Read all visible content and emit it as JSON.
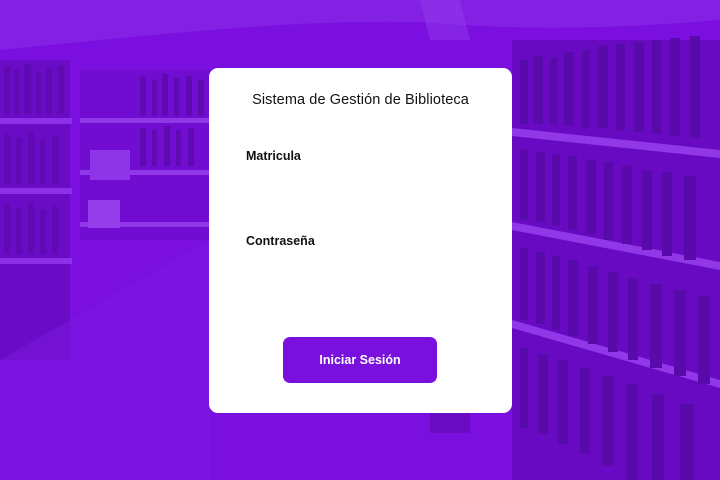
{
  "colors": {
    "background_overlay": "#7a0fe0",
    "card": "#ffffff",
    "button": "#7a10dd",
    "button_text": "#ffffff"
  },
  "login": {
    "title": "Sistema de Gestión de Biblioteca",
    "matricula_label": "Matricula",
    "matricula_value": "",
    "password_label": "Contraseña",
    "password_value": "",
    "submit_label": "Iniciar Sesión"
  }
}
